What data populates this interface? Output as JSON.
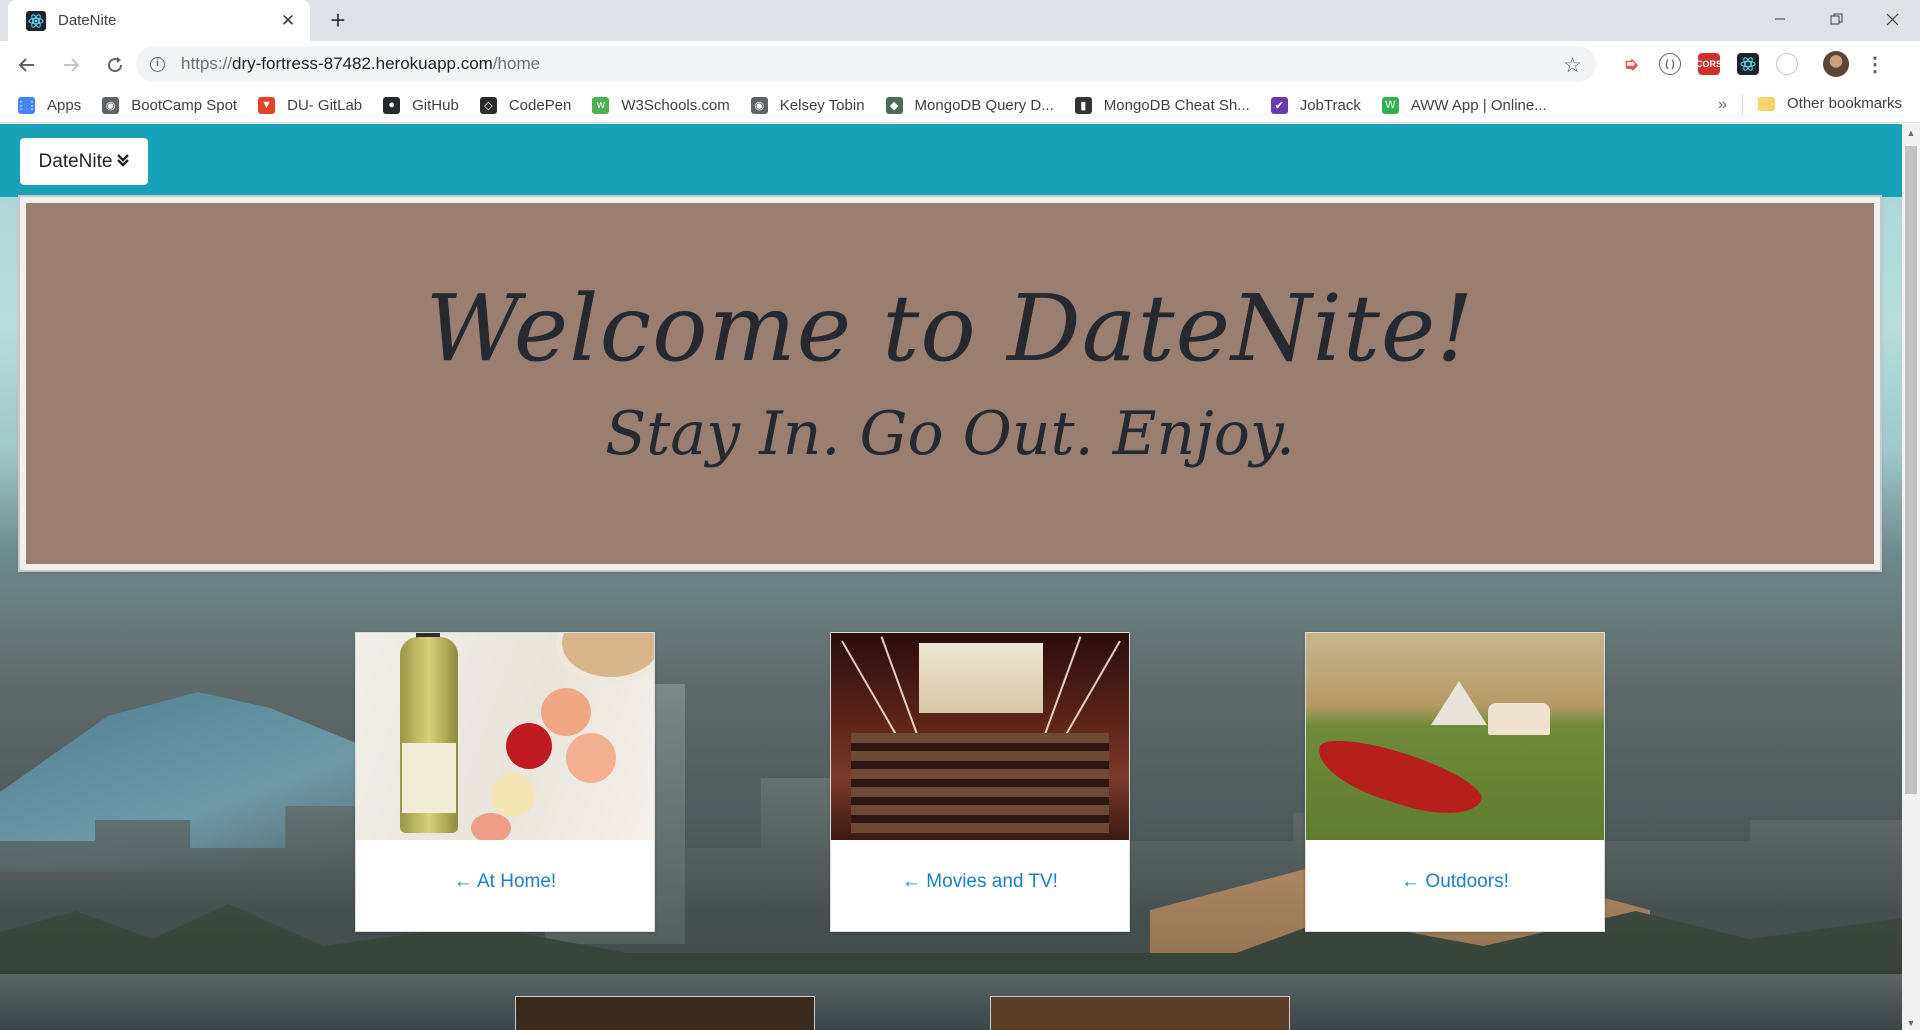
{
  "browser": {
    "tab_title": "DateNite",
    "new_tab": "+",
    "close_glyph": "✕",
    "url_scheme": "https://",
    "url_host": "dry-fortress-87482.herokuapp.com",
    "url_path": "/home",
    "bookmarks": [
      {
        "label": "Apps",
        "icon": "apps-grid-icon",
        "color": "#4285f4"
      },
      {
        "label": "BootCamp Spot",
        "icon": "globe-icon",
        "color": "#5f6368"
      },
      {
        "label": "DU- GitLab",
        "icon": "gitlab-icon",
        "color": "#e24329"
      },
      {
        "label": "GitHub",
        "icon": "github-icon",
        "color": "#24292e"
      },
      {
        "label": "CodePen",
        "icon": "codepen-icon",
        "color": "#2b2b2b"
      },
      {
        "label": "W3Schools.com",
        "icon": "w3schools-icon",
        "color": "#4caf50"
      },
      {
        "label": "Kelsey Tobin",
        "icon": "globe-icon",
        "color": "#5f6368"
      },
      {
        "label": "MongoDB Query D...",
        "icon": "mongodb-icon",
        "color": "#4a6b57"
      },
      {
        "label": "MongoDB Cheat Sh...",
        "icon": "bookmark-doc-icon",
        "color": "#333333"
      },
      {
        "label": "JobTrack",
        "icon": "jobtrack-icon",
        "color": "#6a3bb0"
      },
      {
        "label": "AWW App | Online...",
        "icon": "aww-app-icon",
        "color": "#2fb24c"
      }
    ],
    "bookmarks_more": "»",
    "other_bookmarks": "Other bookmarks"
  },
  "page": {
    "brand_label": "DateNite",
    "jumbotron_title": "Welcome to DateNite!",
    "jumbotron_subtitle": "Stay In. Go Out. Enjoy.",
    "cards": [
      {
        "label": "← At Home!",
        "image": "wine-and-roses-photo"
      },
      {
        "label": "← Movies and TV!",
        "image": "movie-theater-photo"
      },
      {
        "label": "← Outdoors!",
        "image": "outdoor-picnic-canoe-photo"
      }
    ]
  },
  "colors": {
    "navbar": "#17a2b8",
    "jumbotron": "#9a7f71",
    "link": "#1e7ccf"
  }
}
